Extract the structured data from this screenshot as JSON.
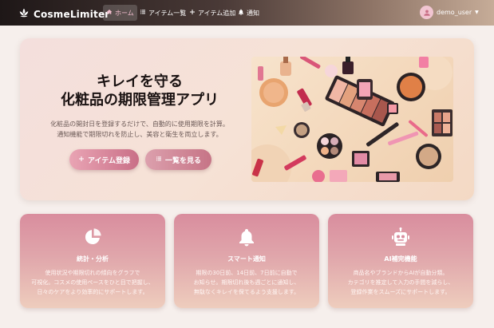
{
  "navbar": {
    "brand": "CosmeLimiter",
    "links": [
      {
        "label": "ホーム",
        "icon": "home-icon",
        "active": true
      },
      {
        "label": "アイテム一覧",
        "icon": "list-icon"
      },
      {
        "label": "アイテム追加",
        "icon": "plus-icon"
      },
      {
        "label": "通知",
        "icon": "bell-icon"
      }
    ],
    "user": {
      "name": "demo_user",
      "icon": "user-icon"
    }
  },
  "hero": {
    "title_line1": "キレイを守る",
    "title_line2": "化粧品の期限管理アプリ",
    "desc_line1": "化粧品の開封日を登録するだけで、自動的に使用期限を計算。",
    "desc_line2": "通知機能で期限切れを防止し、美容と衛生を両立します。",
    "buttons": [
      {
        "label": "アイテム登録",
        "icon": "plus-icon"
      },
      {
        "label": "一覧を見る",
        "icon": "list-icon"
      }
    ],
    "image_alt": "cosmetics-flatlay-image"
  },
  "features": [
    {
      "icon": "pie-chart-icon",
      "title": "統計・分析",
      "lines": [
        "使用状況や期限切れの傾向をグラフで",
        "可視化。コスメの使用ペースをひと目で把握し、",
        "日々のケアをより効率的にサポートします。"
      ]
    },
    {
      "icon": "bell-icon",
      "title": "スマート通知",
      "lines": [
        "期限の30日前、14日前、7日前に自動で",
        "お知らせ。期限切れ後も週ごとに通知し、",
        "無駄なくキレイを保てるよう支援します。"
      ]
    },
    {
      "icon": "robot-icon",
      "title": "AI補完機能",
      "lines": [
        "商品名やブランドからAIが自動分類。",
        "カテゴリを推定して入力の手間を減らし、",
        "登録作業をスムーズにサポートします。"
      ]
    }
  ],
  "colors": {
    "accent": "#c96f87",
    "nav_active": "#f6bfd0"
  }
}
